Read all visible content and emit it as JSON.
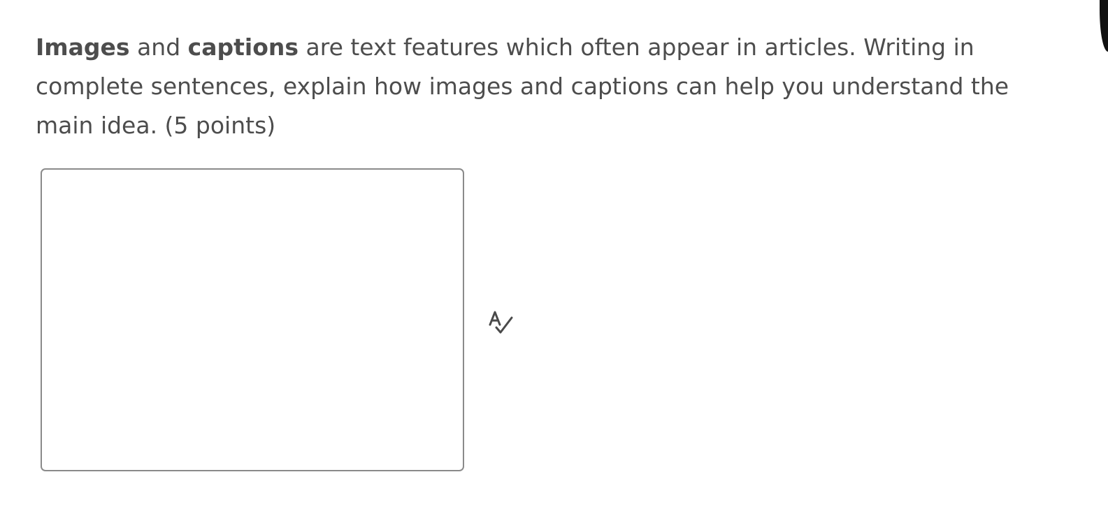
{
  "question": {
    "term1": "Images",
    "connector": " and ",
    "term2": "captions",
    "rest": " are text features which often appear in articles. Writing in complete sentences, explain how images and captions can help you understand the main idea. (5 points)"
  },
  "answer": {
    "value": "",
    "placeholder": ""
  },
  "icons": {
    "spellcheck": "spellcheck-icon"
  },
  "colors": {
    "text": "#4d4d4d",
    "border": "#8a8a8a",
    "background": "#ffffff"
  }
}
